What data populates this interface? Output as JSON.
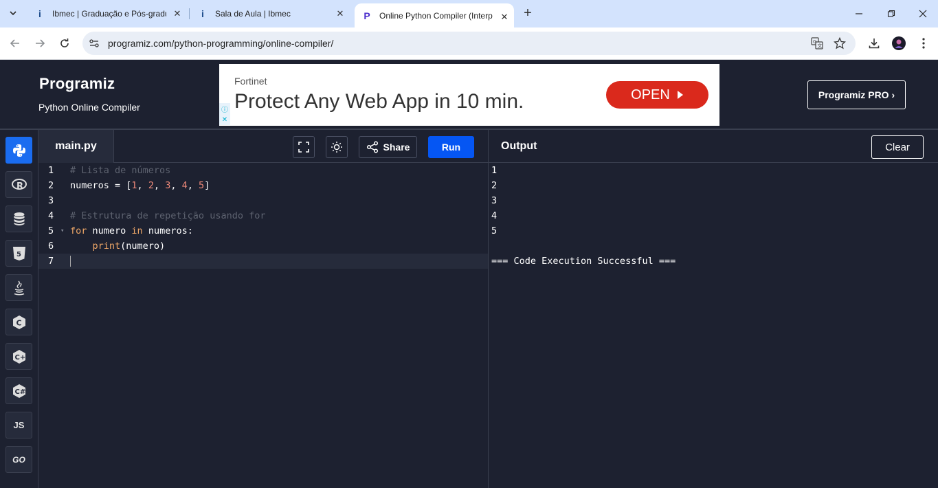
{
  "browser": {
    "tabs": [
      {
        "title": "Ibmec | Graduação e Pós-gradu",
        "favicon": "ibmec-favicon"
      },
      {
        "title": "Sala de Aula | Ibmec",
        "favicon": "ibmec-favicon"
      },
      {
        "title": "Online Python Compiler (Interp",
        "favicon": "programiz-favicon",
        "active": true
      }
    ],
    "url": "programiz.com/python-programming/online-compiler/"
  },
  "header": {
    "logo": "Programiz",
    "subtitle": "Python Online Compiler",
    "pro_button": "Programiz PRO ›"
  },
  "ad": {
    "brand": "Fortinet",
    "headline": "Protect Any Web App in 10 min.",
    "cta": "OPEN"
  },
  "sidebar": {
    "languages": [
      {
        "name": "python",
        "label": "",
        "active": true
      },
      {
        "name": "r",
        "label": "R"
      },
      {
        "name": "sql",
        "label": ""
      },
      {
        "name": "html",
        "label": "5"
      },
      {
        "name": "java",
        "label": ""
      },
      {
        "name": "c",
        "label": "C"
      },
      {
        "name": "cpp",
        "label": "C+"
      },
      {
        "name": "csharp",
        "label": "C#"
      },
      {
        "name": "javascript",
        "label": "JS"
      },
      {
        "name": "go",
        "label": "GO"
      }
    ]
  },
  "editor": {
    "filename": "main.py",
    "share_label": "Share",
    "run_label": "Run",
    "line_numbers": [
      "1",
      "2",
      "3",
      "4",
      "5",
      "6",
      "7"
    ],
    "lines": {
      "l1": "# Lista de números",
      "l2_name": "numeros = [",
      "l2_n1": "1",
      "l2_n2": "2",
      "l2_n3": "3",
      "l2_n4": "4",
      "l2_n5": "5",
      "l4": "# Estrutura de repetição usando for",
      "l5_for": "for",
      "l5_var": " numero ",
      "l5_in": "in",
      "l5_rest": " numeros:",
      "l6_indent": "    ",
      "l6_fn": "print",
      "l6_rest": "(numero)"
    }
  },
  "output": {
    "title": "Output",
    "clear_label": "Clear",
    "lines": [
      "1",
      "2",
      "3",
      "4",
      "5",
      "",
      "=== Code Execution Successful ==="
    ]
  }
}
